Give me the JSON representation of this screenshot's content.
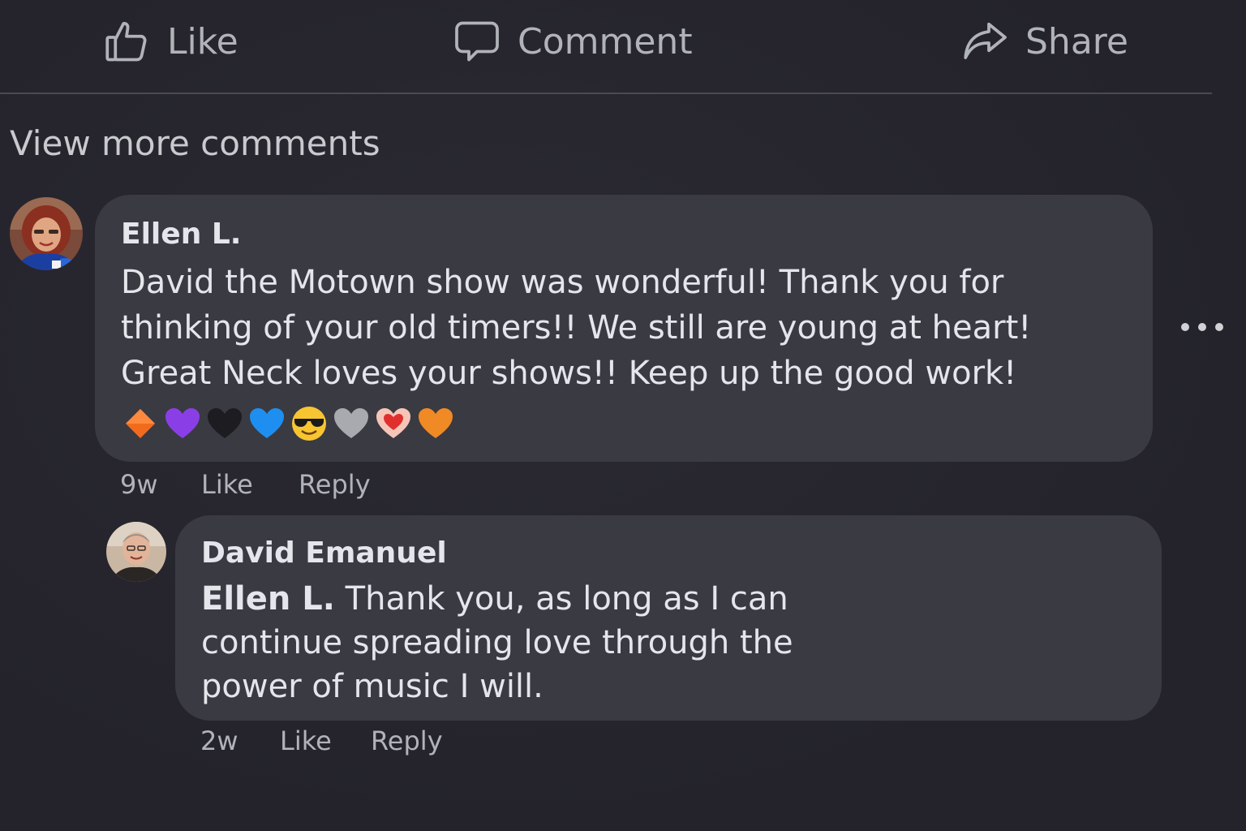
{
  "action_bar": {
    "like_label": "Like",
    "comment_label": "Comment",
    "share_label": "Share",
    "icons": [
      "thumbs-up-icon",
      "speech-bubble-icon",
      "share-arrow-icon"
    ]
  },
  "view_more_label": "View more comments",
  "comments": [
    {
      "author": "Ellen L.",
      "text": "David the Motown show was wonderful!  Thank you for thinking of your old timers!! We still are young at heart! Great Neck loves your shows!! Keep up the good work!",
      "emojis": [
        "orange-diamond",
        "purple-heart",
        "black-heart",
        "blue-heart",
        "sunglasses-face",
        "grey-heart",
        "heart-with-red-heart",
        "orange-heart"
      ],
      "time": "9w",
      "like_label": "Like",
      "reply_label": "Reply",
      "more_options_icon": "ellipsis-icon"
    }
  ],
  "reply": {
    "author": "David Emanuel",
    "mention": "Ellen L.",
    "text": " Thank you, as long as I can continue spreading love through the power of music I will.",
    "time": "2w",
    "like_label": "Like",
    "reply_label": "Reply"
  },
  "colors": {
    "background": "#26252d",
    "bubble": "#3a3a42",
    "primary_text": "#e4e6eb",
    "secondary_text": "#b0b3b8",
    "divider": "#4b4a52"
  }
}
